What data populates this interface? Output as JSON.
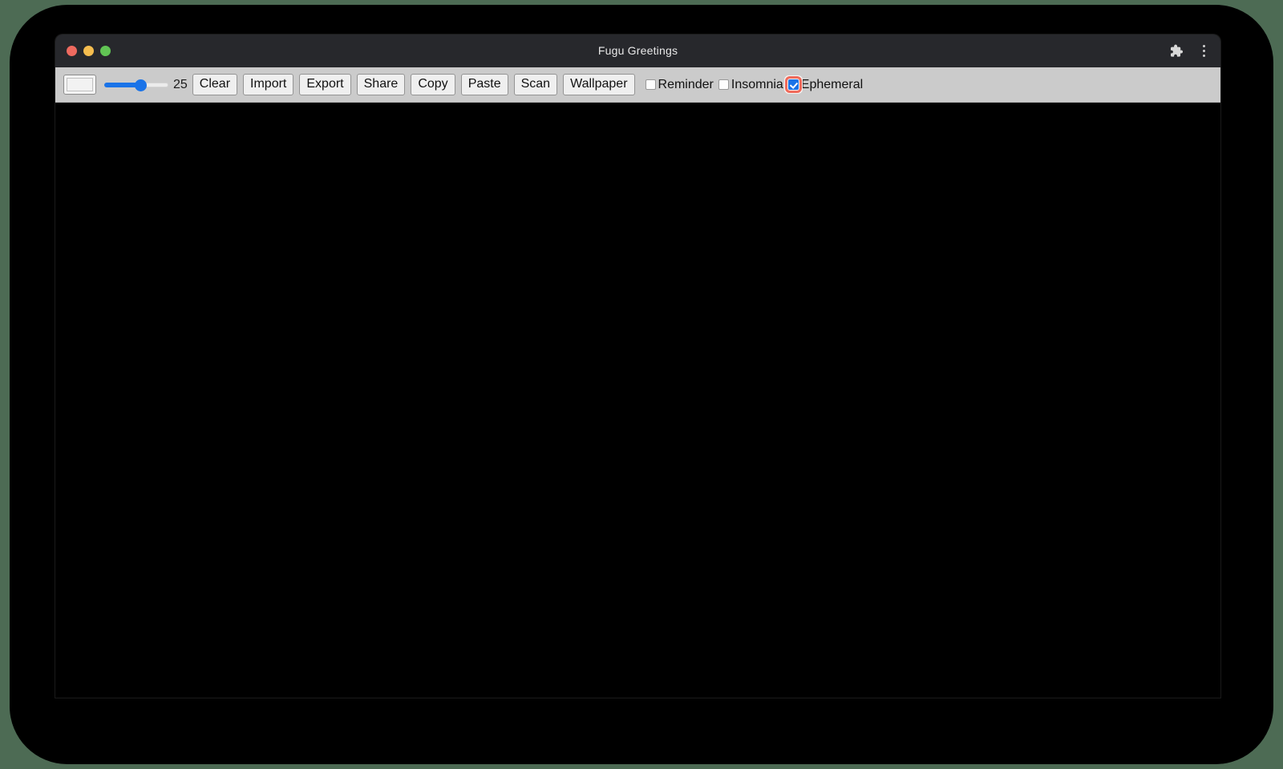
{
  "window": {
    "title": "Fugu Greetings",
    "traffic_lights": [
      {
        "name": "close",
        "color": "#ee6a5f"
      },
      {
        "name": "minimize",
        "color": "#f5bd4f"
      },
      {
        "name": "maximize",
        "color": "#61c454"
      }
    ],
    "title_bar_actions": [
      {
        "name": "extensions-icon",
        "label": "Extensions"
      },
      {
        "name": "menu-icon",
        "label": "More"
      }
    ]
  },
  "toolbar": {
    "color_picker": {
      "value": "#f2f2f2"
    },
    "line_width": {
      "value": "25",
      "min": "1",
      "max": "50",
      "fill_percent": 50
    },
    "buttons": [
      {
        "id": "clear",
        "label": "Clear"
      },
      {
        "id": "import",
        "label": "Import"
      },
      {
        "id": "export",
        "label": "Export"
      },
      {
        "id": "share",
        "label": "Share"
      },
      {
        "id": "copy",
        "label": "Copy"
      },
      {
        "id": "paste",
        "label": "Paste"
      },
      {
        "id": "scan",
        "label": "Scan"
      },
      {
        "id": "wallpaper",
        "label": "Wallpaper"
      }
    ],
    "checkboxes": [
      {
        "id": "reminder",
        "label": "Reminder",
        "checked": false,
        "focused": false
      },
      {
        "id": "insomnia",
        "label": "Insomnia",
        "checked": false,
        "focused": false
      },
      {
        "id": "ephemeral",
        "label": "Ephemeral",
        "checked": true,
        "focused": true
      }
    ]
  },
  "canvas": {
    "background": "#000000"
  },
  "colors": {
    "accent": "#1a73e8",
    "focus_ring": "#f06a5a",
    "toolbar_bg": "#cbcbcb",
    "titlebar_bg": "#27282c",
    "desktop_bg": "#4d6b54"
  }
}
